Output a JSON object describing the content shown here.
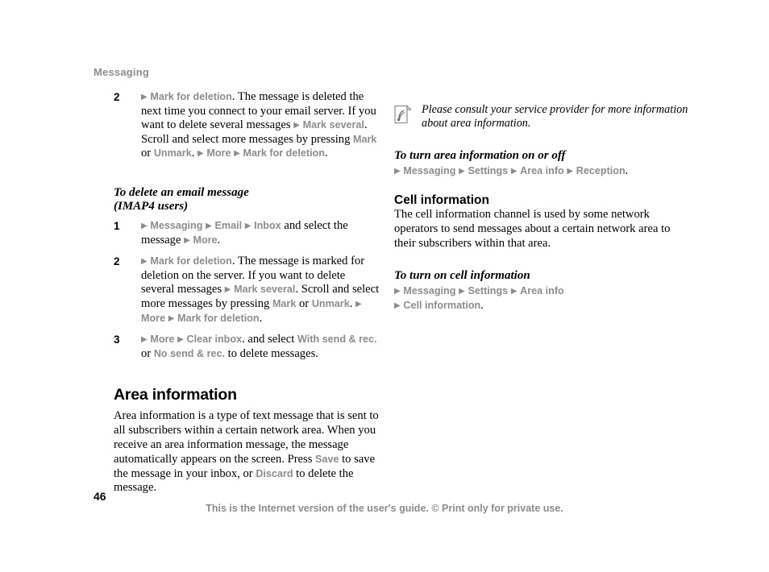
{
  "document": {
    "header": "Messaging",
    "page_number": "46",
    "footer": "This is the Internet version of the user's guide. © Print only for private use."
  },
  "icons": {
    "arrow": "▶",
    "note": "note-signal-icon"
  },
  "left_column": {
    "step2_email_delete": {
      "num": "2",
      "segments": [
        {
          "type": "arrow"
        },
        {
          "type": "nav",
          "text": "Mark for deletion"
        },
        {
          "type": "plain",
          "text": ". The message is deleted the next time you connect to your email server. If you want to delete several messages "
        },
        {
          "type": "arrow"
        },
        {
          "type": "nav",
          "text": "Mark several"
        },
        {
          "type": "plain",
          "text": ". Scroll and select more messages by pressing "
        },
        {
          "type": "nav",
          "text": "Mark"
        },
        {
          "type": "plain",
          "text": " or "
        },
        {
          "type": "nav",
          "text": "Unmark"
        },
        {
          "type": "plain",
          "text": ". "
        },
        {
          "type": "arrow"
        },
        {
          "type": "nav",
          "text": "More"
        },
        {
          "type": "plain",
          "text": " "
        },
        {
          "type": "arrow"
        },
        {
          "type": "nav",
          "text": "Mark for deletion"
        },
        {
          "type": "plain",
          "text": "."
        }
      ]
    },
    "imap_heading_line1": "To delete an email message",
    "imap_heading_line2": "(IMAP4 users)",
    "step1_imap": {
      "num": "1",
      "segments": [
        {
          "type": "arrow"
        },
        {
          "type": "nav",
          "text": "Messaging"
        },
        {
          "type": "plain",
          "text": " "
        },
        {
          "type": "arrow"
        },
        {
          "type": "nav",
          "text": "Email"
        },
        {
          "type": "plain",
          "text": " "
        },
        {
          "type": "arrow"
        },
        {
          "type": "nav",
          "text": "Inbox"
        },
        {
          "type": "plain",
          "text": " and select the message "
        },
        {
          "type": "arrow"
        },
        {
          "type": "nav",
          "text": "More"
        },
        {
          "type": "plain",
          "text": "."
        }
      ]
    },
    "step2_imap": {
      "num": "2",
      "segments": [
        {
          "type": "arrow"
        },
        {
          "type": "nav",
          "text": "Mark for deletion"
        },
        {
          "type": "plain",
          "text": ". The message is marked for deletion on the server. If you want to delete several messages "
        },
        {
          "type": "arrow"
        },
        {
          "type": "nav",
          "text": "Mark several"
        },
        {
          "type": "plain",
          "text": ". Scroll and select more messages by pressing "
        },
        {
          "type": "nav",
          "text": "Mark"
        },
        {
          "type": "plain",
          "text": " or "
        },
        {
          "type": "nav",
          "text": "Unmark"
        },
        {
          "type": "plain",
          "text": ". "
        },
        {
          "type": "arrow"
        },
        {
          "type": "nav",
          "text": "More"
        },
        {
          "type": "plain",
          "text": " "
        },
        {
          "type": "arrow"
        },
        {
          "type": "nav",
          "text": "Mark for deletion"
        },
        {
          "type": "plain",
          "text": "."
        }
      ]
    },
    "step3_imap": {
      "num": "3",
      "segments": [
        {
          "type": "arrow"
        },
        {
          "type": "nav",
          "text": "More"
        },
        {
          "type": "plain",
          "text": " "
        },
        {
          "type": "arrow"
        },
        {
          "type": "nav",
          "text": "Clear inbox"
        },
        {
          "type": "plain",
          "text": ". and select "
        },
        {
          "type": "nav",
          "text": "With send & rec."
        },
        {
          "type": "plain",
          "text": " or "
        },
        {
          "type": "nav",
          "text": "No send & rec."
        },
        {
          "type": "plain",
          "text": " to delete messages."
        }
      ]
    },
    "area_info_heading": "Area information",
    "area_info_body": [
      {
        "type": "plain",
        "text": "Area information is a type of text message that is sent to all subscribers within a certain network area. When you receive an area information message, the message automatically appears on the screen. Press "
      },
      {
        "type": "nav",
        "text": "Save"
      },
      {
        "type": "plain",
        "text": " to save the message in your inbox, or "
      },
      {
        "type": "nav",
        "text": "Discard"
      },
      {
        "type": "plain",
        "text": " to delete the message."
      }
    ]
  },
  "right_column": {
    "note_text": "Please consult your service provider for more information about area information.",
    "turn_area_heading": "To turn area information on or off",
    "turn_area_path": [
      {
        "type": "arrow"
      },
      {
        "type": "nav",
        "text": "Messaging"
      },
      {
        "type": "plain",
        "text": " "
      },
      {
        "type": "arrow"
      },
      {
        "type": "nav",
        "text": "Settings"
      },
      {
        "type": "plain",
        "text": " "
      },
      {
        "type": "arrow"
      },
      {
        "type": "nav",
        "text": "Area info"
      },
      {
        "type": "plain",
        "text": " "
      },
      {
        "type": "arrow"
      },
      {
        "type": "nav",
        "text": "Reception"
      },
      {
        "type": "plain",
        "text": "."
      }
    ],
    "cell_info_heading": "Cell information",
    "cell_info_body": "The cell information channel is used by some network operators to send messages about a certain network area to their subscribers within that area.",
    "turn_cell_heading": "To turn on cell information",
    "turn_cell_path_line1": [
      {
        "type": "arrow"
      },
      {
        "type": "nav",
        "text": "Messaging"
      },
      {
        "type": "plain",
        "text": " "
      },
      {
        "type": "arrow"
      },
      {
        "type": "nav",
        "text": "Settings"
      },
      {
        "type": "plain",
        "text": " "
      },
      {
        "type": "arrow"
      },
      {
        "type": "nav",
        "text": "Area info"
      }
    ],
    "turn_cell_path_line2": [
      {
        "type": "arrow"
      },
      {
        "type": "nav",
        "text": "Cell information"
      },
      {
        "type": "plain",
        "text": "."
      }
    ]
  },
  "colors": {
    "nav_grey": "#8c8c8c",
    "text_black": "#000000"
  }
}
